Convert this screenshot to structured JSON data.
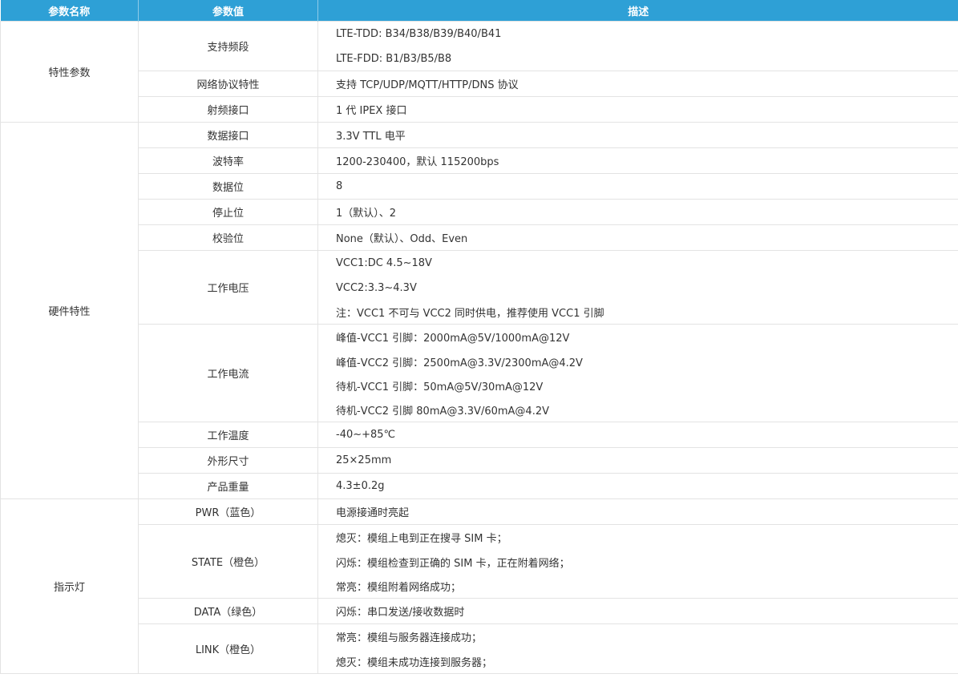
{
  "header": {
    "col_name": "参数名称",
    "col_param": "参数值",
    "col_desc": "描述"
  },
  "groups": [
    {
      "name": "特性参数",
      "rows": [
        {
          "param": "支持频段",
          "lines": [
            "LTE-TDD: B34/B38/B39/B40/B41",
            "LTE-FDD: B1/B3/B5/B8"
          ]
        },
        {
          "param": "网络协议特性",
          "lines": [
            "支持 TCP/UDP/MQTT/HTTP/DNS 协议"
          ]
        },
        {
          "param": "射频接口",
          "lines": [
            "1 代 IPEX 接口"
          ]
        }
      ]
    },
    {
      "name": "硬件特性",
      "rows": [
        {
          "param": "数据接口",
          "lines": [
            "3.3V TTL 电平"
          ]
        },
        {
          "param": "波特率",
          "lines": [
            "1200-230400，默认 115200bps"
          ]
        },
        {
          "param": "数据位",
          "lines": [
            "8"
          ]
        },
        {
          "param": "停止位",
          "lines": [
            "1（默认）、2"
          ]
        },
        {
          "param": "校验位",
          "lines": [
            "None（默认）、Odd、Even"
          ]
        },
        {
          "param": "工作电压",
          "lines": [
            "VCC1:DC 4.5~18V",
            "VCC2:3.3~4.3V",
            "注：VCC1 不可与 VCC2 同时供电，推荐使用 VCC1 引脚"
          ]
        },
        {
          "param": "工作电流",
          "lines": [
            "峰值-VCC1 引脚：2000mA@5V/1000mA@12V",
            "峰值-VCC2 引脚：2500mA@3.3V/2300mA@4.2V",
            "待机-VCC1 引脚：50mA@5V/30mA@12V",
            "待机-VCC2 引脚 80mA@3.3V/60mA@4.2V"
          ]
        },
        {
          "param": "工作温度",
          "lines": [
            "-40~+85℃"
          ]
        },
        {
          "param": "外形尺寸",
          "lines": [
            "25×25mm"
          ]
        },
        {
          "param": "产品重量",
          "lines": [
            "4.3±0.2g"
          ]
        }
      ]
    },
    {
      "name": "指示灯",
      "rows": [
        {
          "param": "PWR（蓝色）",
          "lines": [
            "电源接通时亮起"
          ]
        },
        {
          "param": "STATE（橙色）",
          "lines": [
            "熄灭：模组上电到正在搜寻 SIM 卡；",
            "闪烁：模组检查到正确的 SIM 卡，正在附着网络；",
            "常亮：模组附着网络成功；"
          ]
        },
        {
          "param": "DATA（绿色）",
          "lines": [
            "闪烁：串口发送/接收数据时"
          ]
        },
        {
          "param": "LINK（橙色）",
          "lines": [
            "常亮：模组与服务器连接成功；",
            "熄灭：模组未成功连接到服务器；"
          ]
        }
      ]
    }
  ],
  "colors": {
    "header_bg": "#2ea0d6",
    "header_text": "#ffffff",
    "border": "#e3e3e3",
    "text": "#333333"
  }
}
